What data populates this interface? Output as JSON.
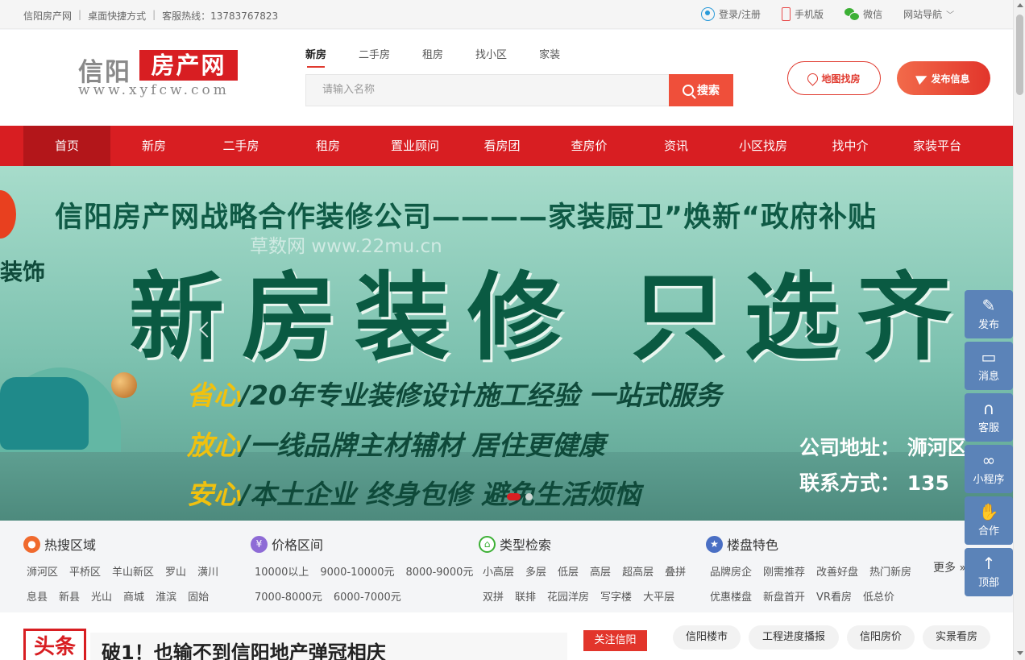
{
  "topbar": {
    "site_name": "信阳房产网",
    "desktop_shortcut": "桌面快捷方式",
    "hotline": "客服热线：13783767823",
    "login": "登录/注册",
    "mobile": "手机版",
    "wechat": "微信",
    "site_nav": "网站导航"
  },
  "logo": {
    "line1": "信阳",
    "line2": "房产网",
    "url": "www.xyfcw.com"
  },
  "search": {
    "tabs": [
      "新房",
      "二手房",
      "租房",
      "找小区",
      "家装"
    ],
    "placeholder": "请输入名称",
    "button": "搜索"
  },
  "header_buttons": {
    "map": "地图找房",
    "publish": "发布信息"
  },
  "nav": [
    "首页",
    "新房",
    "二手房",
    "租房",
    "置业顾问",
    "看房团",
    "查房价",
    "资讯",
    "小区找房",
    "找中介",
    "家装平台"
  ],
  "banner": {
    "line1": "信阳房产网战略合作装修公司————家装厨卫”焕新“政府补贴",
    "big": "新房装修 只选齐",
    "brand": "装饰",
    "watermark": "草数网 www.22mu.cn",
    "slogans": [
      {
        "key": "省心",
        "text": "/20年专业装修设计施工经验 一站式服务"
      },
      {
        "key": "放心",
        "text": "/一线品牌主材辅材 居住更健康"
      },
      {
        "key": "安心",
        "text": "/本土企业 终身包修 避免生活烦恼"
      }
    ],
    "address": "公司地址： 浉河区",
    "contact": "联系方式： 135"
  },
  "filters": {
    "area": {
      "title": "热搜区域",
      "row1": [
        "浉河区",
        "平桥区",
        "羊山新区",
        "罗山",
        "潢川"
      ],
      "row2": [
        "息县",
        "新县",
        "光山",
        "商城",
        "淮滨",
        "固始"
      ]
    },
    "price": {
      "title": "价格区间",
      "row1": [
        "10000以上",
        "9000-10000元",
        "8000-9000元"
      ],
      "row2": [
        "7000-8000元",
        "6000-7000元"
      ]
    },
    "type": {
      "title": "类型检索",
      "row1": [
        "小高层",
        "多层",
        "低层",
        "高层",
        "超高层",
        "叠拼"
      ],
      "row2": [
        "双拼",
        "联排",
        "花园洋房",
        "写字楼",
        "大平层"
      ]
    },
    "feature": {
      "title": "楼盘特色",
      "row1": [
        "品牌房企",
        "刚需推荐",
        "改善好盘",
        "热门新房"
      ],
      "row2": [
        "优惠楼盘",
        "新盘首开",
        "VR看房",
        "低总价"
      ]
    },
    "more": "更多"
  },
  "bottom": {
    "tag": "头条",
    "headline": "破1！也输不到信阳地产弹冠相庆",
    "follow": "关注信阳",
    "pills": [
      "信阳楼市",
      "工程进度播报",
      "信阳房价",
      "实景看房"
    ]
  },
  "float_bar": [
    "发布",
    "消息",
    "客服",
    "小程序",
    "合作",
    "顶部"
  ],
  "colors": {
    "brand_red": "#d81e22",
    "button_orange": "#ef4f3a",
    "float_blue": "#5b83b8"
  }
}
